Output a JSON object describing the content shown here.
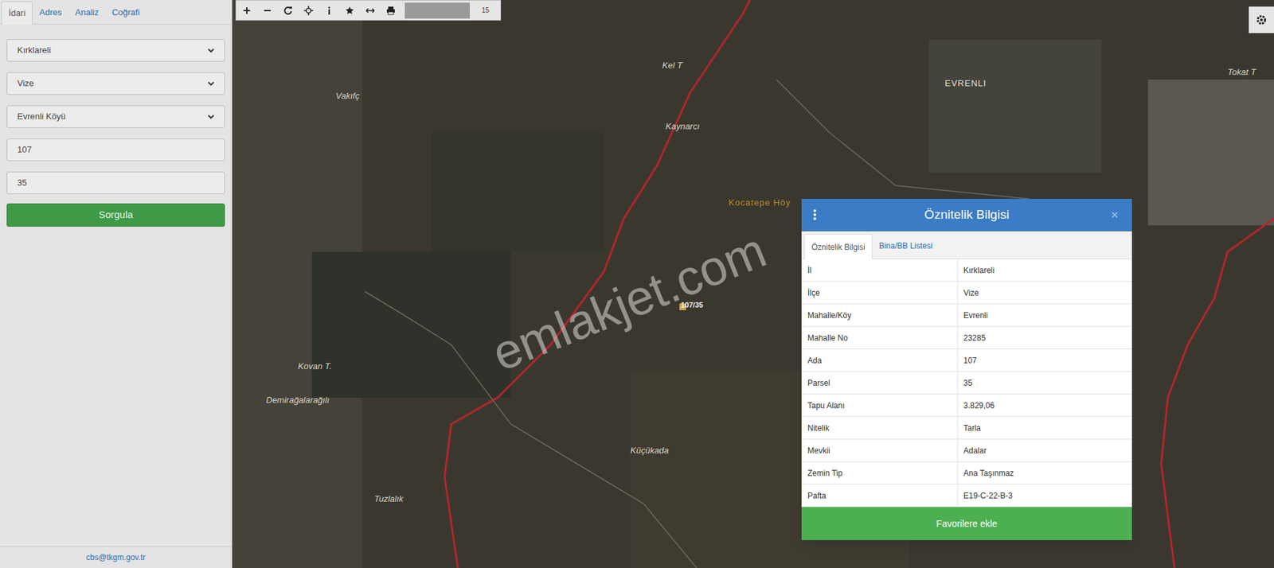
{
  "sidebar": {
    "tabs": [
      {
        "label": "İdari",
        "selected": true
      },
      {
        "label": "Adres",
        "selected": false
      },
      {
        "label": "Analiz",
        "selected": false
      },
      {
        "label": "Coğrafi",
        "selected": false
      }
    ],
    "fields": [
      {
        "kind": "select",
        "value": "Kırklareli"
      },
      {
        "kind": "select",
        "value": "Vize"
      },
      {
        "kind": "select",
        "value": "Evrenli Köyü"
      },
      {
        "kind": "input",
        "value": "107"
      },
      {
        "kind": "input",
        "value": "35"
      }
    ],
    "button": "Sorgula",
    "footer": "cbs@tkgm.gov.tr"
  },
  "toolbar": {
    "zoom": "15"
  },
  "map": {
    "labels": [
      {
        "text": "Vakıfç",
        "kind": "place"
      },
      {
        "text": "Kel T",
        "kind": "place"
      },
      {
        "text": "Kaynarcı",
        "kind": "place"
      },
      {
        "text": "EVRENLI",
        "kind": "village"
      },
      {
        "text": "Tokat T",
        "kind": "place"
      },
      {
        "text": "Kocatepe Höy",
        "kind": "highlight"
      },
      {
        "text": "107/35",
        "kind": "parcel"
      },
      {
        "text": "Kovan T.",
        "kind": "place"
      },
      {
        "text": "Demirağalarağılı",
        "kind": "place"
      },
      {
        "text": "Küçükada",
        "kind": "place"
      },
      {
        "text": "Tuzlalık",
        "kind": "place"
      }
    ],
    "watermark": "emlakjet.com"
  },
  "popup": {
    "title": "Öznitelik Bilgisi",
    "close": "×",
    "tabs": [
      {
        "label": "Öznitelik Bilgisi",
        "selected": true
      },
      {
        "label": "Bina/BB Listesi",
        "selected": false
      }
    ],
    "rows": [
      [
        "İl",
        "Kırklareli"
      ],
      [
        "İlçe",
        "Vize"
      ],
      [
        "Mahalle/Köy",
        "Evrenli"
      ],
      [
        "Mahalle No",
        "23285"
      ],
      [
        "Ada",
        "107"
      ],
      [
        "Parsel",
        "35"
      ],
      [
        "Tapu Alanı",
        "3.829,06"
      ],
      [
        "Nitelik",
        "Tarla"
      ],
      [
        "Mevkii",
        "Adalar"
      ],
      [
        "Zemin Tip",
        "Ana Taşınmaz"
      ],
      [
        "Pafta",
        "E19-C-22-B-3"
      ]
    ],
    "button": "Favorilere ekle"
  }
}
